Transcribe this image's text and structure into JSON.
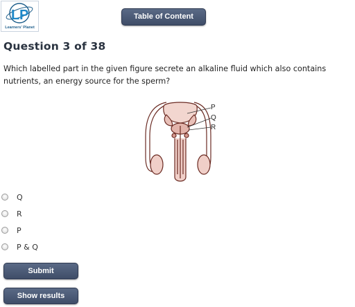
{
  "logo": {
    "text": "Learners' Planet",
    "colors": {
      "brand": "#1e88c8",
      "ring": "#1e5f8c"
    }
  },
  "header": {
    "toc_label": "Table of Content"
  },
  "question": {
    "title": "Question 3 of 38",
    "text": "Which labelled part in the given figure secrete an alkaline fluid which also contains nutrients, an energy source for the sperm?",
    "figure_labels": [
      "P",
      "Q",
      "R"
    ]
  },
  "options": [
    {
      "label": "Q",
      "selected": false
    },
    {
      "label": "R",
      "selected": false
    },
    {
      "label": "P",
      "selected": false
    },
    {
      "label": "P & Q",
      "selected": false
    }
  ],
  "actions": {
    "submit_label": "Submit",
    "results_label": "Show results"
  },
  "colors": {
    "button_bg": "#4a5874",
    "button_text": "#ffffff"
  }
}
